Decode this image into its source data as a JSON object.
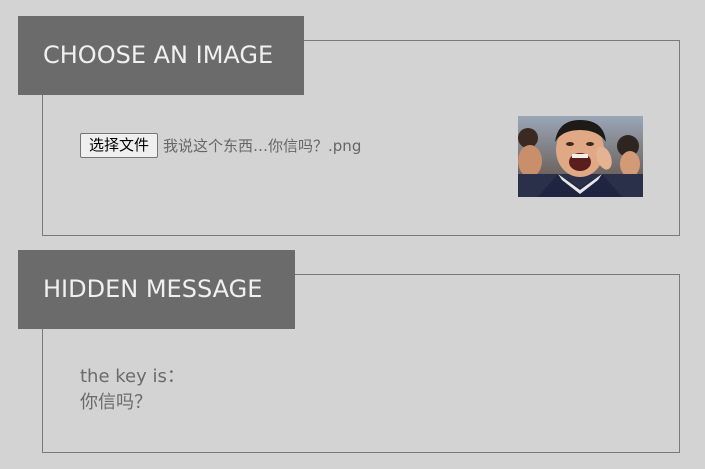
{
  "choose_section": {
    "heading": "CHOOSE AN IMAGE",
    "file_button_label": "选择文件",
    "file_name": "我说这个东西…你信吗？.png"
  },
  "message_section": {
    "heading": "HIDDEN MESSAGE",
    "line1": "the key is：",
    "line2": "你信吗？"
  },
  "colors": {
    "background": "#d3d3d3",
    "header_bg": "#6b6b6b",
    "header_text": "#f0f0f0",
    "border": "#7a7a7a",
    "muted_text": "#6b6b6b"
  }
}
